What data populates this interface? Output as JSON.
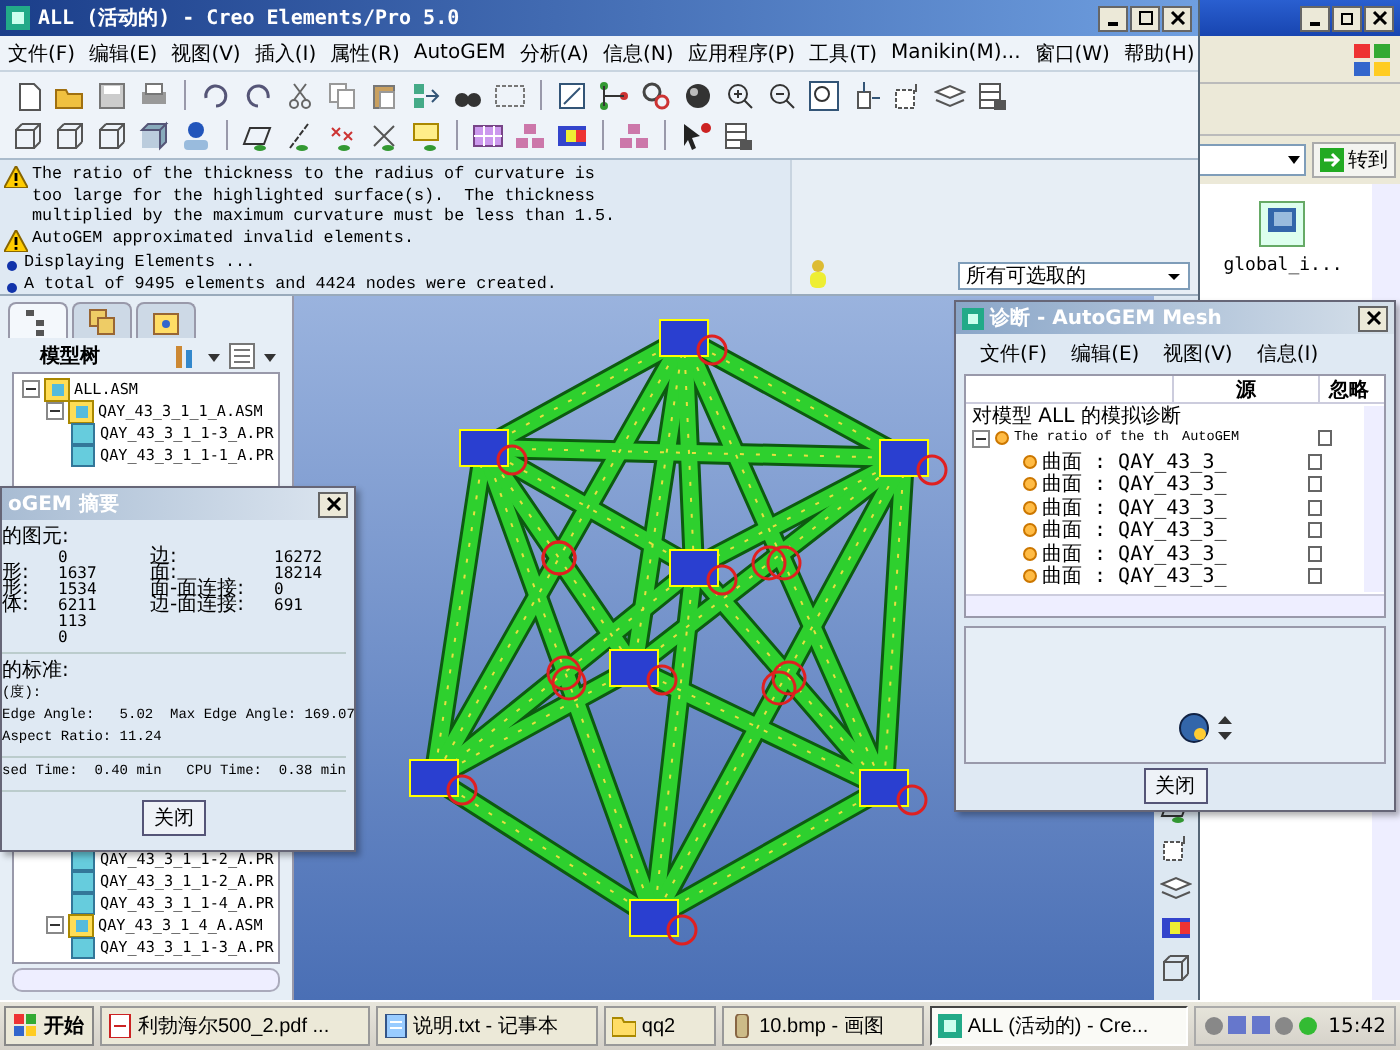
{
  "main_window": {
    "title": "ALL (活动的) - Creo Elements/Pro 5.0",
    "menu": [
      "文件(F)",
      "编辑(E)",
      "视图(V)",
      "插入(I)",
      "属性(R)",
      "AutoGEM",
      "分析(A)",
      "信息(N)",
      "应用程序(P)",
      "工具(T)",
      "Manikin(M)...",
      "窗口(W)",
      "帮助(H)"
    ],
    "messages": [
      {
        "kind": "warning",
        "text": "The ratio of the thickness to the radius of curvature is\ntoo large for the highlighted surface(s).  The thickness\nmultiplied by the maximum curvature must be less than 1.5."
      },
      {
        "kind": "warning",
        "text": "AutoGEM approximated invalid elements."
      },
      {
        "kind": "info",
        "text": "Displaying Elements ..."
      },
      {
        "kind": "info",
        "text": "A total of 9495 elements and 4424 nodes were created."
      }
    ],
    "filter": {
      "value": "所有可选取的"
    },
    "model_tree": {
      "title": "模型树",
      "tabs": [
        {
          "selected": true
        },
        {
          "selected": false
        },
        {
          "selected": false
        }
      ],
      "items": [
        {
          "label": "ALL.ASM",
          "kind": "assembly",
          "expanded": true,
          "children": [
            {
              "label": "QAY_43_3_1_1_A.ASM",
              "kind": "assembly",
              "expanded": true,
              "children": [
                {
                  "label": "QAY_43_3_1_1-3_A.PR",
                  "kind": "part"
                },
                {
                  "label": "QAY_43_3_1_1-1_A.PR",
                  "kind": "part"
                },
                {
                  "label": "QAY_43_3_1_1-2_A.PR",
                  "kind": "part"
                },
                {
                  "label": "QAY_43_3_1_1-2_A.PR",
                  "kind": "part"
                },
                {
                  "label": "QAY_43_3_1_1-4_A.PR",
                  "kind": "part"
                }
              ]
            },
            {
              "label": "QAY_43_3_1_4_A.ASM",
              "kind": "assembly",
              "expanded": true,
              "children": [
                {
                  "label": "QAY_43_3_1_1-3_A.PR",
                  "kind": "part"
                }
              ]
            }
          ]
        }
      ]
    }
  },
  "summary_dialog": {
    "title": "oGEM 摘要",
    "section_elements": "的图元:",
    "stats_left": [
      {
        "value": "0"
      },
      {
        "label": "形:",
        "value": "1637"
      },
      {
        "label": "形:",
        "value": "1534"
      },
      {
        "label": "体:",
        "value": "6211"
      },
      {
        "value": "113"
      },
      {
        "value": "0"
      }
    ],
    "stats_right": [
      {
        "label": "边:",
        "value": "16272"
      },
      {
        "label": "面:",
        "value": "18214"
      },
      {
        "label": "面-面连接:",
        "value": "0"
      },
      {
        "label": "边-面连接:",
        "value": "691"
      }
    ],
    "section_criteria": "的标准:",
    "unit": "(度):",
    "angles": "Edge Angle:   5.02  Max Edge Angle: 169.07",
    "aspect": "Aspect Ratio: 11.24",
    "elapsed": "sed Time:  0.40 min",
    "cpu": "CPU Time:  0.38 min",
    "button": "关闭"
  },
  "diagnostics_dialog": {
    "title": "诊断 - AutoGEM Mesh",
    "menu": [
      "文件(F)",
      "编辑(E)",
      "视图(V)",
      "信息(I)"
    ],
    "columns": {
      "source": "源",
      "ignore": "忽略"
    },
    "root": "对模型 ALL 的模拟诊断",
    "issues": [
      {
        "text": "The ratio of the th",
        "source": "AutoGEM",
        "expanded": true,
        "ignored": false,
        "children": [
          {
            "text": "曲面 : QAY_43_3_",
            "ignored": false
          },
          {
            "text": "曲面 : QAY_43_3_",
            "ignored": false
          },
          {
            "text": "曲面 : QAY_43_3_",
            "ignored": false
          },
          {
            "text": "曲面 : QAY_43_3_",
            "ignored": false
          },
          {
            "text": "曲面 : QAY_43_3_",
            "ignored": false
          },
          {
            "text": "曲面 : QAY_43_3_",
            "ignored": false
          }
        ]
      }
    ],
    "button": "关闭"
  },
  "explorer_window": {
    "go_button": "转到",
    "files": [
      {
        "label": "global_i..."
      }
    ]
  },
  "taskbar": {
    "start": "开始",
    "tasks": [
      {
        "label": "利勃海尔500_2.pdf ...",
        "kind": "pdf",
        "selected": false
      },
      {
        "label": "说明.txt - 记事本",
        "kind": "notepad",
        "selected": false
      },
      {
        "label": "qq2",
        "kind": "folder",
        "selected": false
      },
      {
        "label": "10.bmp - 画图",
        "kind": "paint",
        "selected": false
      },
      {
        "label": "ALL (活动的) - Cre...",
        "kind": "app",
        "selected": true
      }
    ],
    "clock": "15:42"
  }
}
